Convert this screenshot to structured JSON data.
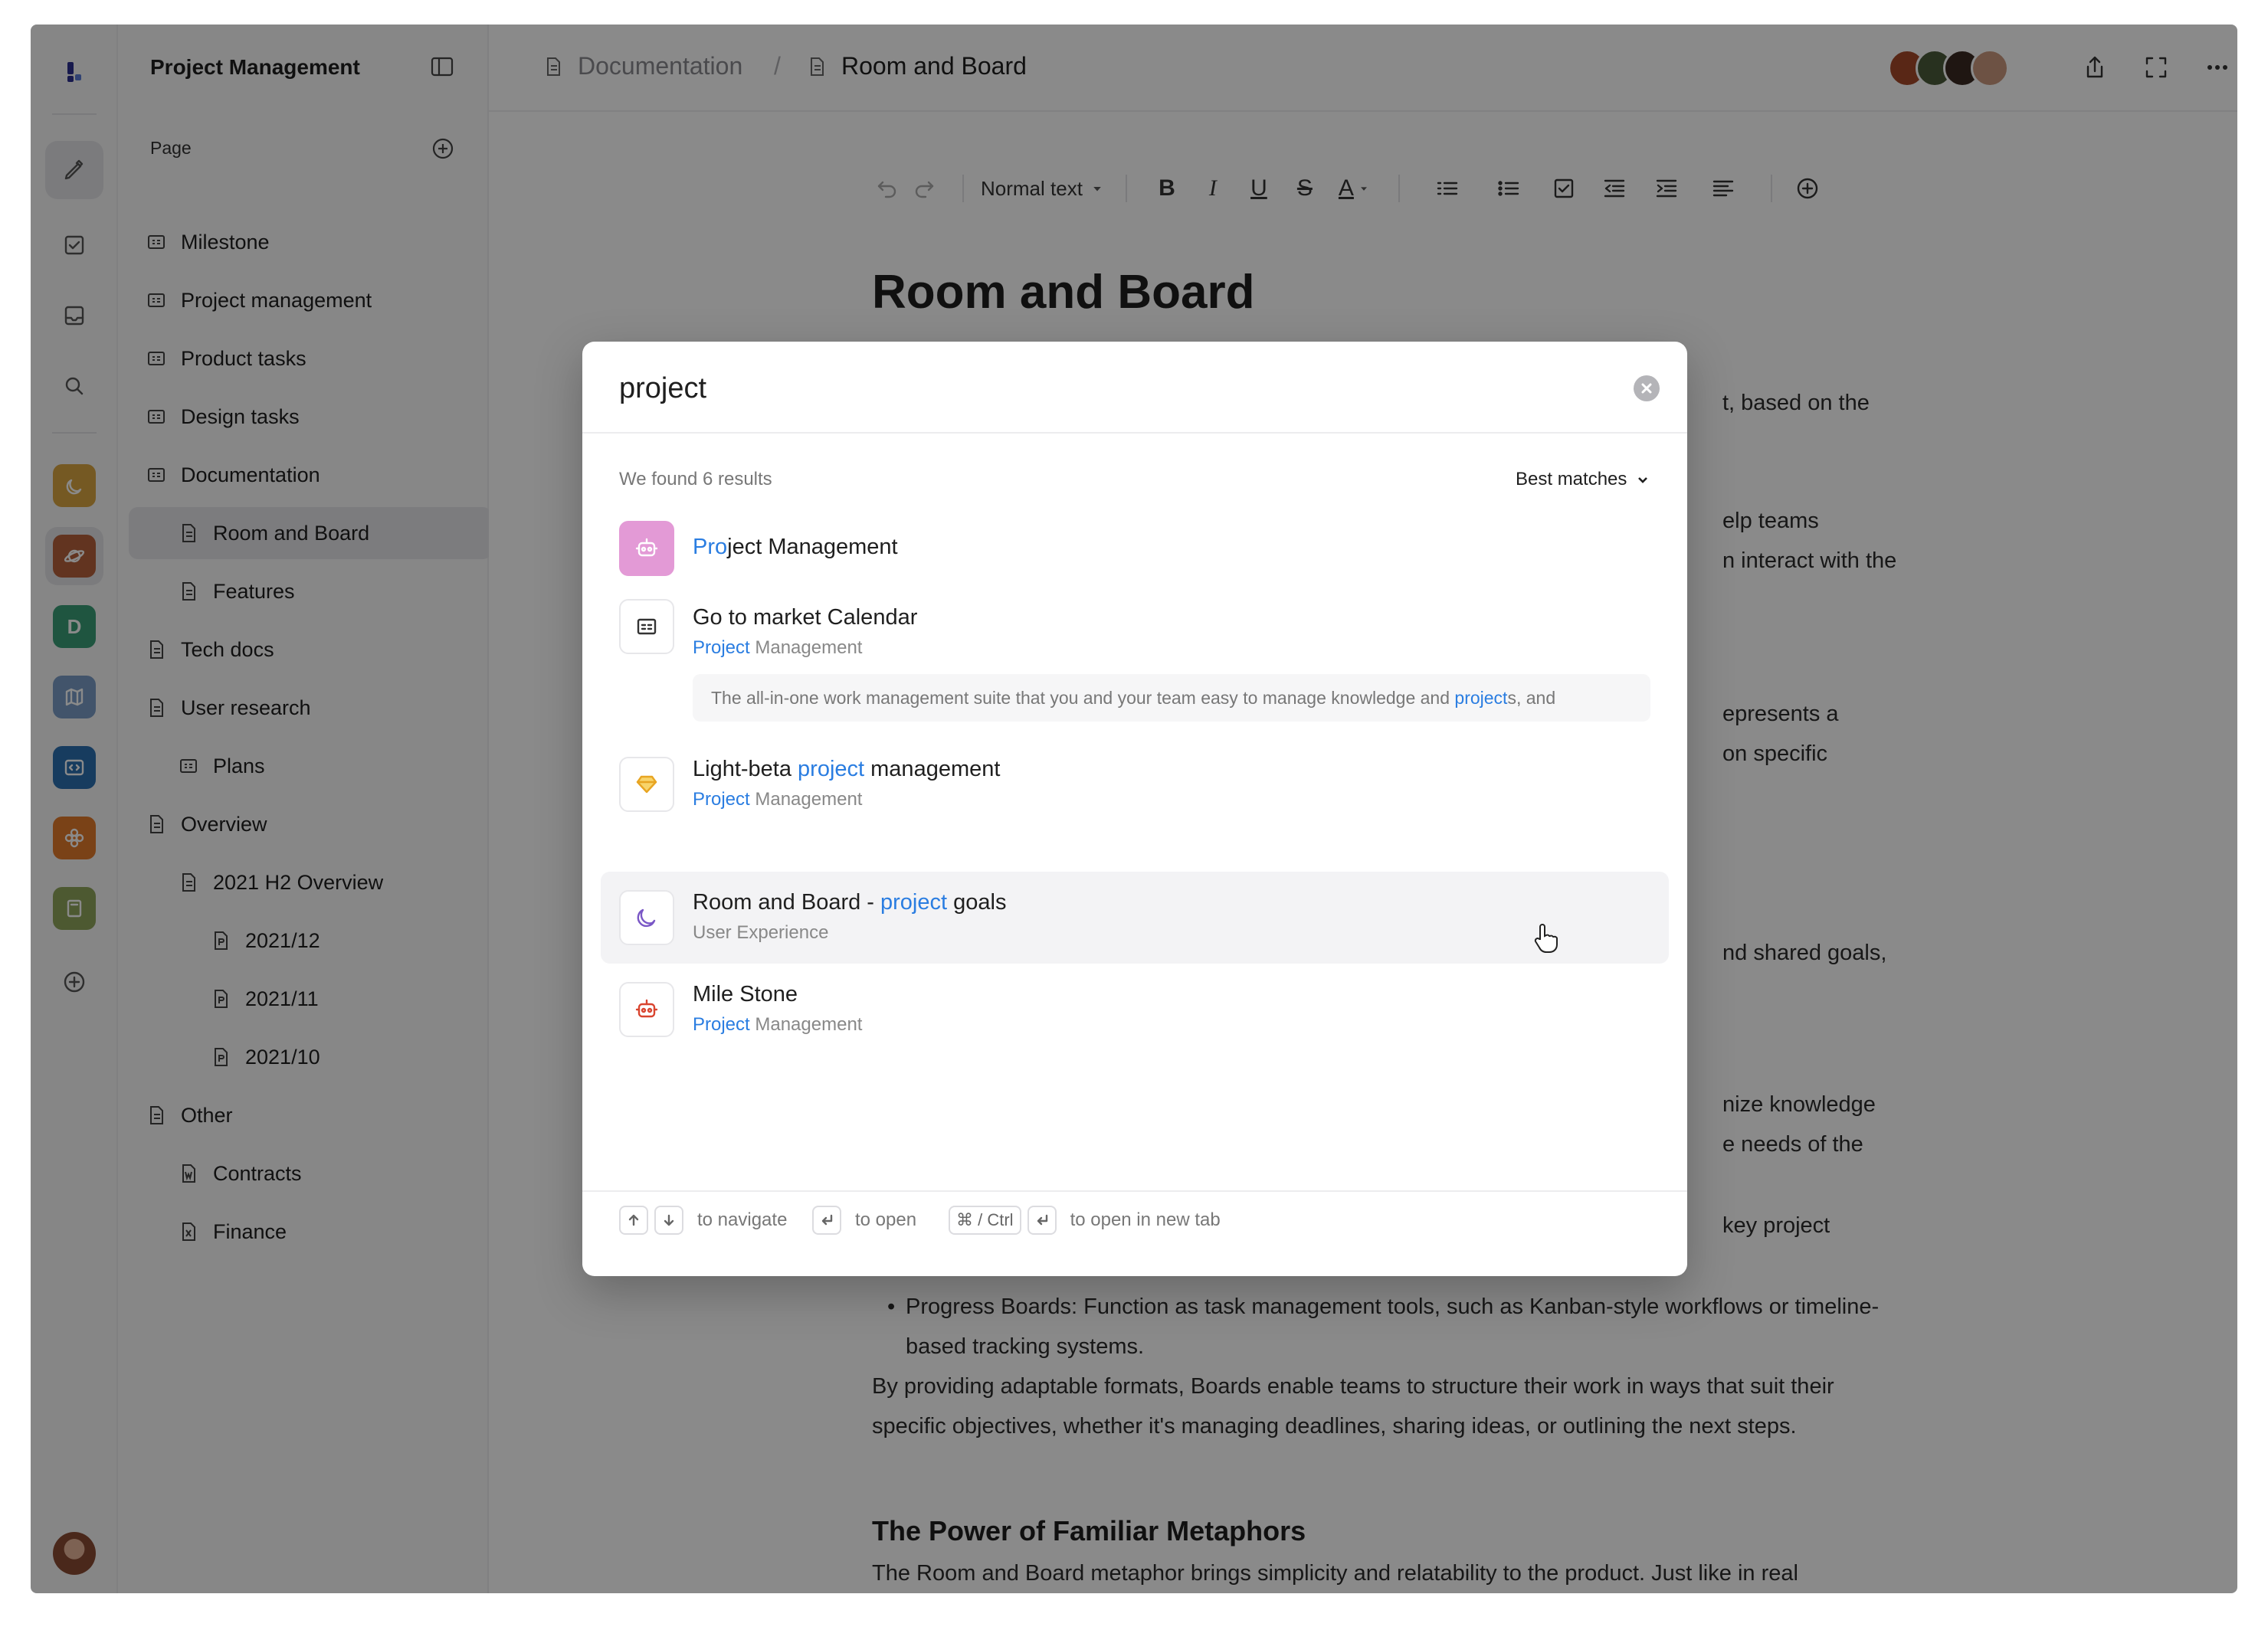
{
  "sidebar": {
    "title": "Project Management",
    "section_label": "Page",
    "items": [
      {
        "label": "Milestone",
        "icon": "board-icon"
      },
      {
        "label": "Project management",
        "icon": "board-icon"
      },
      {
        "label": "Product tasks",
        "icon": "board-icon"
      },
      {
        "label": "Design tasks",
        "icon": "board-icon"
      },
      {
        "label": "Documentation",
        "icon": "board-icon"
      },
      {
        "label": "Room and Board",
        "icon": "doc-icon",
        "active": true
      },
      {
        "label": "Features",
        "icon": "doc-icon"
      },
      {
        "label": "Tech docs",
        "icon": "doc-icon"
      },
      {
        "label": "User research",
        "icon": "doc-icon"
      },
      {
        "label": "Plans",
        "icon": "board-icon"
      },
      {
        "label": "Overview",
        "icon": "doc-icon"
      },
      {
        "label": "2021 H2 Overview",
        "icon": "doc-icon"
      },
      {
        "label": "2021/12",
        "icon": "p-file-icon"
      },
      {
        "label": "2021/11",
        "icon": "p-file-icon"
      },
      {
        "label": "2021/10",
        "icon": "p-file-icon"
      },
      {
        "label": "Other",
        "icon": "doc-icon"
      },
      {
        "label": "Contracts",
        "icon": "word-file-icon"
      },
      {
        "label": "Finance",
        "icon": "excel-file-icon"
      }
    ]
  },
  "rail": {
    "workspaces": [
      {
        "name": "moon-workspace",
        "color": "#d9a441"
      },
      {
        "name": "planet-workspace",
        "color": "#b5613c"
      },
      {
        "name": "D",
        "color": "#3a9e77"
      },
      {
        "name": "map-workspace",
        "color": "#7a9cc6"
      },
      {
        "name": "code-workspace",
        "color": "#2c6fb0"
      },
      {
        "name": "flower-workspace",
        "color": "#e27a2c"
      },
      {
        "name": "book-workspace",
        "color": "#8fa45c"
      }
    ]
  },
  "breadcrumb": {
    "parent": "Documentation",
    "separator": "/",
    "current": "Room and Board"
  },
  "toolbar": {
    "text_style": "Normal text"
  },
  "document": {
    "title": "Room and Board",
    "visible_fragments": [
      "t, based on the",
      "elp teams",
      "n interact with the",
      "epresents a",
      "on specific",
      "nd shared goals,",
      "nize knowledge",
      "e needs of the",
      "key project"
    ],
    "bullet": "Progress Boards: Function as task management tools, such as Kanban-style workflows or timeline-based tracking systems.",
    "paragraph": "By providing adaptable formats, Boards enable teams to structure their work in ways that suit their specific objectives, whether it's managing deadlines, sharing ideas, or outlining the next steps.",
    "heading2": "The Power of Familiar Metaphors",
    "last_line": "The Room and Board metaphor brings simplicity and relatability to the product. Just like in real"
  },
  "search": {
    "query": "project",
    "results_count_label": "We found 6 results",
    "sort_label": "Best matches",
    "results": [
      {
        "title_pre": "",
        "title_hl": "Pro",
        "title_post": "ject Management",
        "sub_hl": "",
        "sub_post": "",
        "icon": "robot-icon"
      },
      {
        "title_pre": "Go to market Calendar",
        "title_hl": "",
        "title_post": "",
        "sub_hl": "Project",
        "sub_post": " Management",
        "icon": "board-icon",
        "snippet_pre": "The all-in-one work management suite that you and your team easy to manage knowledge and ",
        "snippet_hl": "project",
        "snippet_post": "s, and"
      },
      {
        "title_pre": "Light-beta ",
        "title_hl": "project",
        "title_post": " management",
        "sub_hl": "Project",
        "sub_post": " Management",
        "icon": "sketch-icon"
      },
      {
        "title_pre": "Room and Board - ",
        "title_hl": "project",
        "title_post": " goals",
        "sub_hl": "",
        "sub_post": "User Experience",
        "icon": "moon-icon"
      },
      {
        "title_pre": "Mile Stone",
        "title_hl": "",
        "title_post": "",
        "sub_hl": "Project",
        "sub_post": " Management",
        "icon": "robot-icon"
      }
    ],
    "hints": {
      "navigate": "to navigate",
      "open": "to open",
      "modifier": "⌘ / Ctrl",
      "open_new_tab": "to open in new tab"
    }
  }
}
